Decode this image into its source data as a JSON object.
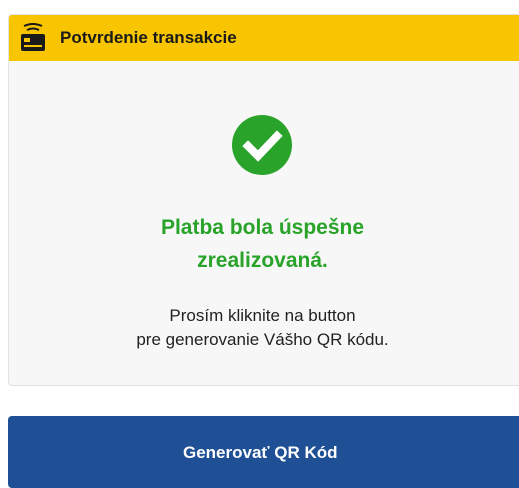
{
  "header": {
    "title": "Potvrdenie transakcie",
    "icon": "card-terminal-icon",
    "bg_color": "#f8c500"
  },
  "status": {
    "icon": "check-circle-icon",
    "color": "#29a329",
    "line1": "Platba bola úspešne",
    "line2": "zrealizovaná."
  },
  "instructions": {
    "line1": "Prosím kliknite na button",
    "line2": "pre generovanie Vášho QR kódu."
  },
  "action": {
    "label": "Generovať QR Kód",
    "color": "#1f4f94"
  }
}
